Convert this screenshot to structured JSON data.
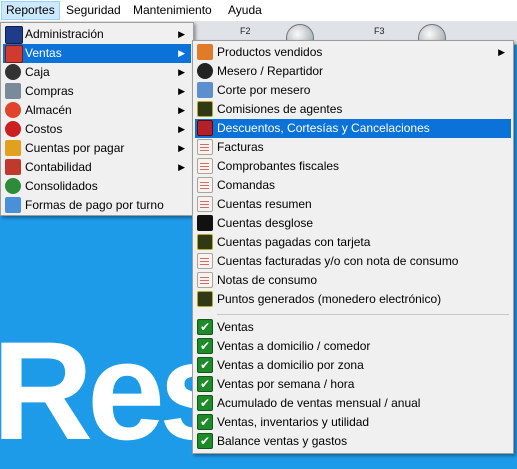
{
  "menubar": {
    "items": [
      {
        "label": "Reportes",
        "open": true
      },
      {
        "label": "Seguridad"
      },
      {
        "label": "Mantenimiento"
      },
      {
        "label": "Ayuda"
      }
    ]
  },
  "toolbar": {
    "keys": [
      "F2",
      "F3"
    ]
  },
  "background": {
    "brand_text": "Res"
  },
  "reportes_menu": {
    "items": [
      {
        "label": "Administración",
        "icon": "monitor-icon",
        "submenu": true
      },
      {
        "label": "Ventas",
        "icon": "sales-icon",
        "submenu": true,
        "highlighted": true
      },
      {
        "label": "Caja",
        "icon": "cash-register-icon",
        "submenu": true
      },
      {
        "label": "Compras",
        "icon": "shopping-cart-icon",
        "submenu": true
      },
      {
        "label": "Almacén",
        "icon": "warehouse-icon",
        "submenu": true
      },
      {
        "label": "Costos",
        "icon": "costs-icon",
        "submenu": true
      },
      {
        "label": "Cuentas por pagar",
        "icon": "payables-icon",
        "submenu": true
      },
      {
        "label": "Contabilidad",
        "icon": "accounting-icon",
        "submenu": true
      },
      {
        "label": "Consolidados",
        "icon": "globe-icon",
        "submenu": false
      },
      {
        "label": "Formas de pago por turno",
        "icon": "payment-shift-icon",
        "submenu": false
      }
    ]
  },
  "ventas_menu": {
    "group1": [
      {
        "label": "Productos vendidos",
        "icon": "products-sold-icon",
        "submenu": true
      },
      {
        "label": "Mesero / Repartidor",
        "icon": "waiter-icon"
      },
      {
        "label": "Corte por mesero",
        "icon": "waiter-cut-icon"
      },
      {
        "label": "Comisiones de agentes",
        "icon": "commissions-icon"
      },
      {
        "label": "Descuentos, Cortesías y Cancelaciones",
        "icon": "discounts-icon",
        "highlighted": true
      },
      {
        "label": "Facturas",
        "icon": "invoice-icon"
      },
      {
        "label": "Comprobantes fiscales",
        "icon": "fiscal-receipt-icon"
      },
      {
        "label": "Comandas",
        "icon": "order-ticket-icon"
      },
      {
        "label": "Cuentas resumen",
        "icon": "summary-accounts-icon"
      },
      {
        "label": "Cuentas desglose",
        "icon": "breakdown-accounts-icon"
      },
      {
        "label": "Cuentas pagadas con tarjeta",
        "icon": "card-paid-icon"
      },
      {
        "label": "Cuentas facturadas y/o con nota de consumo",
        "icon": "invoiced-accounts-icon"
      },
      {
        "label": "Notas de consumo",
        "icon": "consumption-note-icon"
      },
      {
        "label": "Puntos generados (monedero electrónico)",
        "icon": "points-icon"
      }
    ],
    "group2": [
      {
        "label": "Ventas",
        "icon": "check-report-icon"
      },
      {
        "label": "Ventas a domicilio / comedor",
        "icon": "check-report-icon"
      },
      {
        "label": "Ventas a domicilio por zona",
        "icon": "check-report-icon"
      },
      {
        "label": "Ventas por semana / hora",
        "icon": "check-report-icon"
      },
      {
        "label": "Acumulado de ventas mensual / anual",
        "icon": "check-report-icon"
      },
      {
        "label": "Ventas, inventarios y utilidad",
        "icon": "check-report-icon"
      },
      {
        "label": "Balance ventas y gastos",
        "icon": "check-report-icon"
      }
    ]
  },
  "colors": {
    "highlight": "#0a72d8",
    "menu_bg": "#f0f0f0",
    "app_bg": "#1e9be8"
  }
}
